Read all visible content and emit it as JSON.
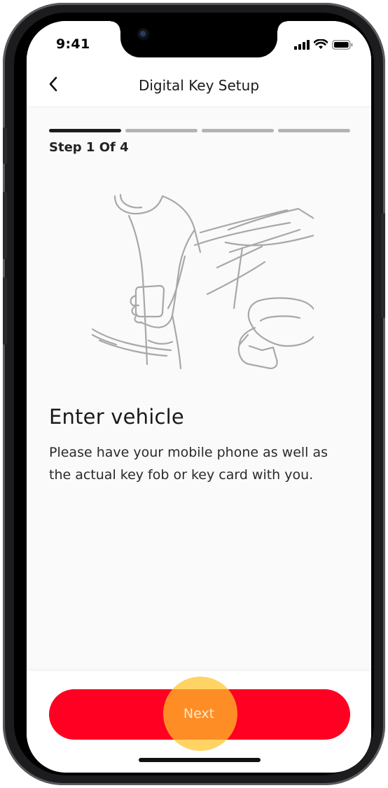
{
  "status_bar": {
    "time": "9:41",
    "icons": [
      "signal-icon",
      "wifi-icon",
      "battery-icon"
    ]
  },
  "nav": {
    "title": "Digital Key Setup",
    "back_icon": "chevron-left-icon"
  },
  "progress": {
    "total_steps": 4,
    "current_step": 1,
    "label": "Step 1 Of 4"
  },
  "illustration": {
    "icon": "person-entering-car-illustration"
  },
  "content": {
    "heading": "Enter vehicle",
    "body": "Please have your mobile phone as well as the actual key fob or key card with you."
  },
  "footer": {
    "next_label": "Next"
  },
  "colors": {
    "primary_button": "#ff0022",
    "tap_highlight": "#ffc428",
    "progress_active": "#1c1c1c",
    "progress_inactive": "#b3b3b3",
    "background": "#fafafa"
  }
}
